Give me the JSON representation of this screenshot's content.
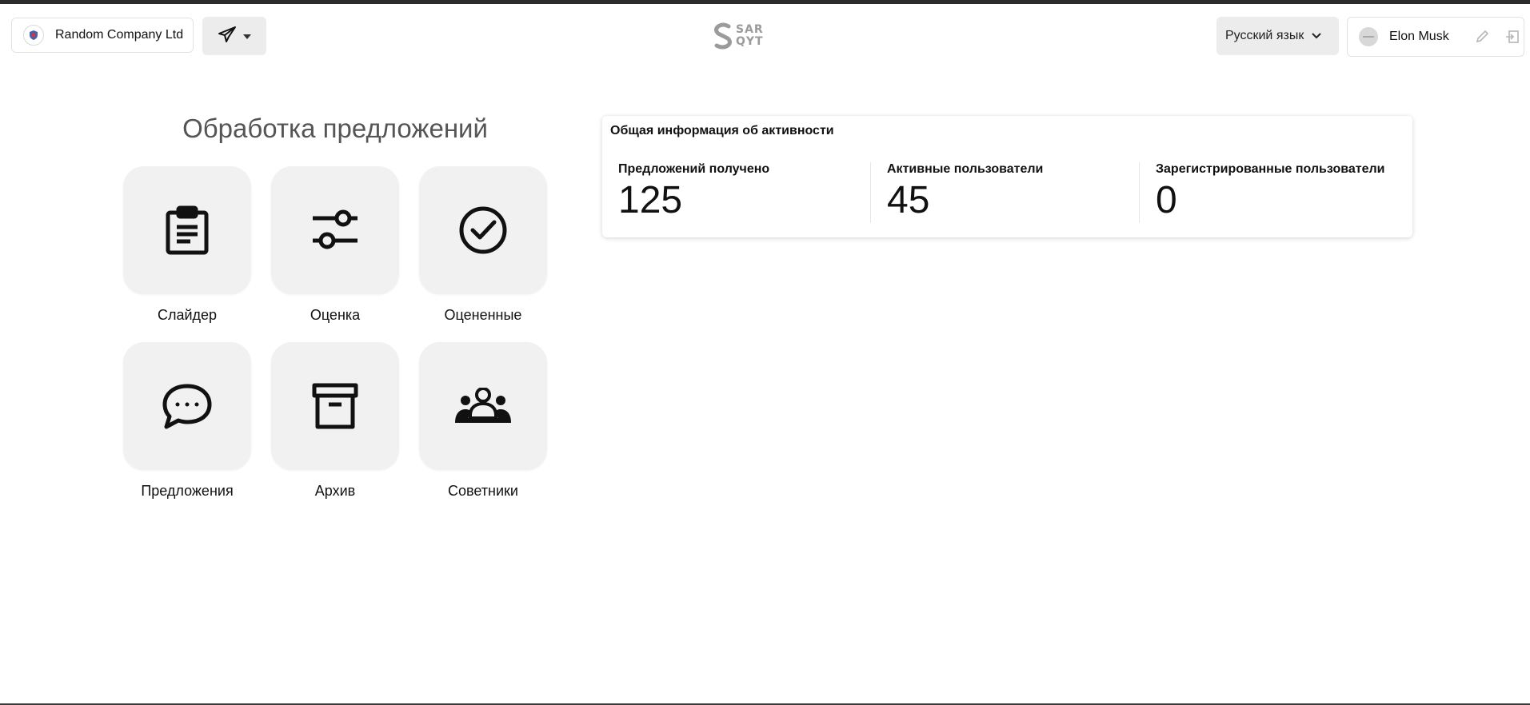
{
  "header": {
    "company": "Random Company Ltd",
    "brand_lines": [
      "SAR",
      "QYT"
    ],
    "language": "Русский язык",
    "user_name": "Elon Musk"
  },
  "section": {
    "title": "Обработка предложений",
    "tiles": [
      {
        "label": "Слайдер",
        "icon": "clipboard-icon"
      },
      {
        "label": "Оценка",
        "icon": "sliders-icon"
      },
      {
        "label": "Оцененные",
        "icon": "check-circle-icon"
      },
      {
        "label": "Предложения",
        "icon": "chat-bubble-icon"
      },
      {
        "label": "Архив",
        "icon": "archive-box-icon"
      },
      {
        "label": "Советники",
        "icon": "users-group-icon"
      }
    ]
  },
  "stats": {
    "title": "Общая информация об активности",
    "items": [
      {
        "label": "Предложений получено",
        "value": "125"
      },
      {
        "label": "Активные пользователи",
        "value": "45"
      },
      {
        "label": "Зарегистрированные пользователи",
        "value": "0"
      }
    ]
  }
}
